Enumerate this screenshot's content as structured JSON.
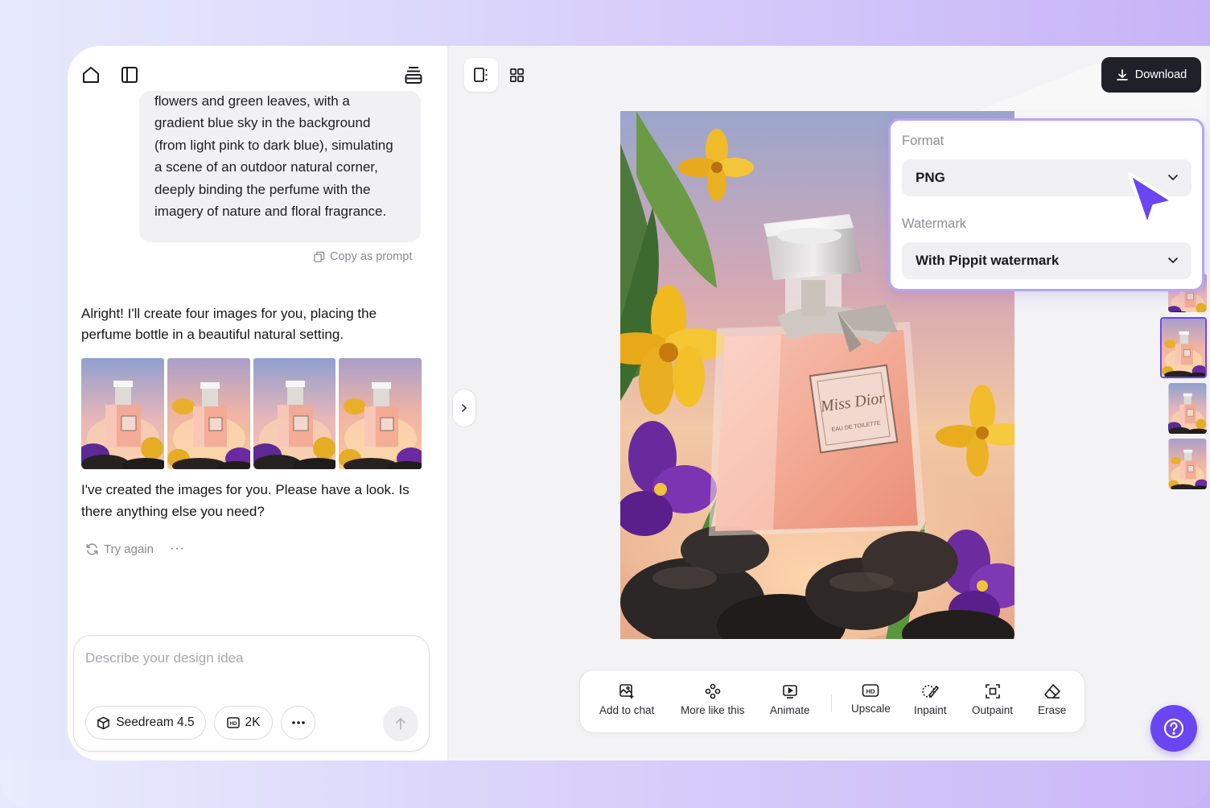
{
  "chat": {
    "header_icons": [
      "home-icon",
      "sidebar-toggle-icon",
      "stack-icon"
    ],
    "user_prompt_lines": [
      "flowers and green leaves, with a",
      "gradient blue sky in the background",
      "(from light pink to dark blue), simulating",
      "a scene of an outdoor natural corner,",
      "deeply binding the perfume with the",
      "imagery of nature and floral fragrance."
    ],
    "copy_as_prompt": "Copy as prompt",
    "assistant_intro": "Alright! I'll create four images for you, placing the perfume bottle in a beautiful natural setting.",
    "assistant_done": "I've created the images for you. Please have a look. Is there anything else you need?",
    "try_again": "Try again",
    "more": "···",
    "input_placeholder": "Describe your design idea",
    "model_chip": "Seedream 4.5",
    "resolution_chip": "2K"
  },
  "canvas": {
    "download_label": "Download",
    "format": {
      "label": "Format",
      "value": "PNG"
    },
    "watermark": {
      "label": "Watermark",
      "value": "With Pippit watermark"
    },
    "bottle_label_text": "Miss Dior",
    "bottle_sublabel_text": "EAU DE TOILETTE",
    "tools": [
      {
        "label": "Add to chat",
        "icon": "add-to-chat-icon"
      },
      {
        "label": "More like this",
        "icon": "more-like-this-icon"
      },
      {
        "label": "Animate",
        "icon": "animate-icon"
      },
      {
        "label": "Upscale",
        "icon": "hd-icon"
      },
      {
        "label": "Inpaint",
        "icon": "inpaint-brush-icon"
      },
      {
        "label": "Outpaint",
        "icon": "outpaint-icon"
      },
      {
        "label": "Erase",
        "icon": "eraser-icon"
      }
    ]
  },
  "colors": {
    "accent": "#6a45f2",
    "download_bg": "#1f2129",
    "panel_border": "#b6a5f6"
  }
}
